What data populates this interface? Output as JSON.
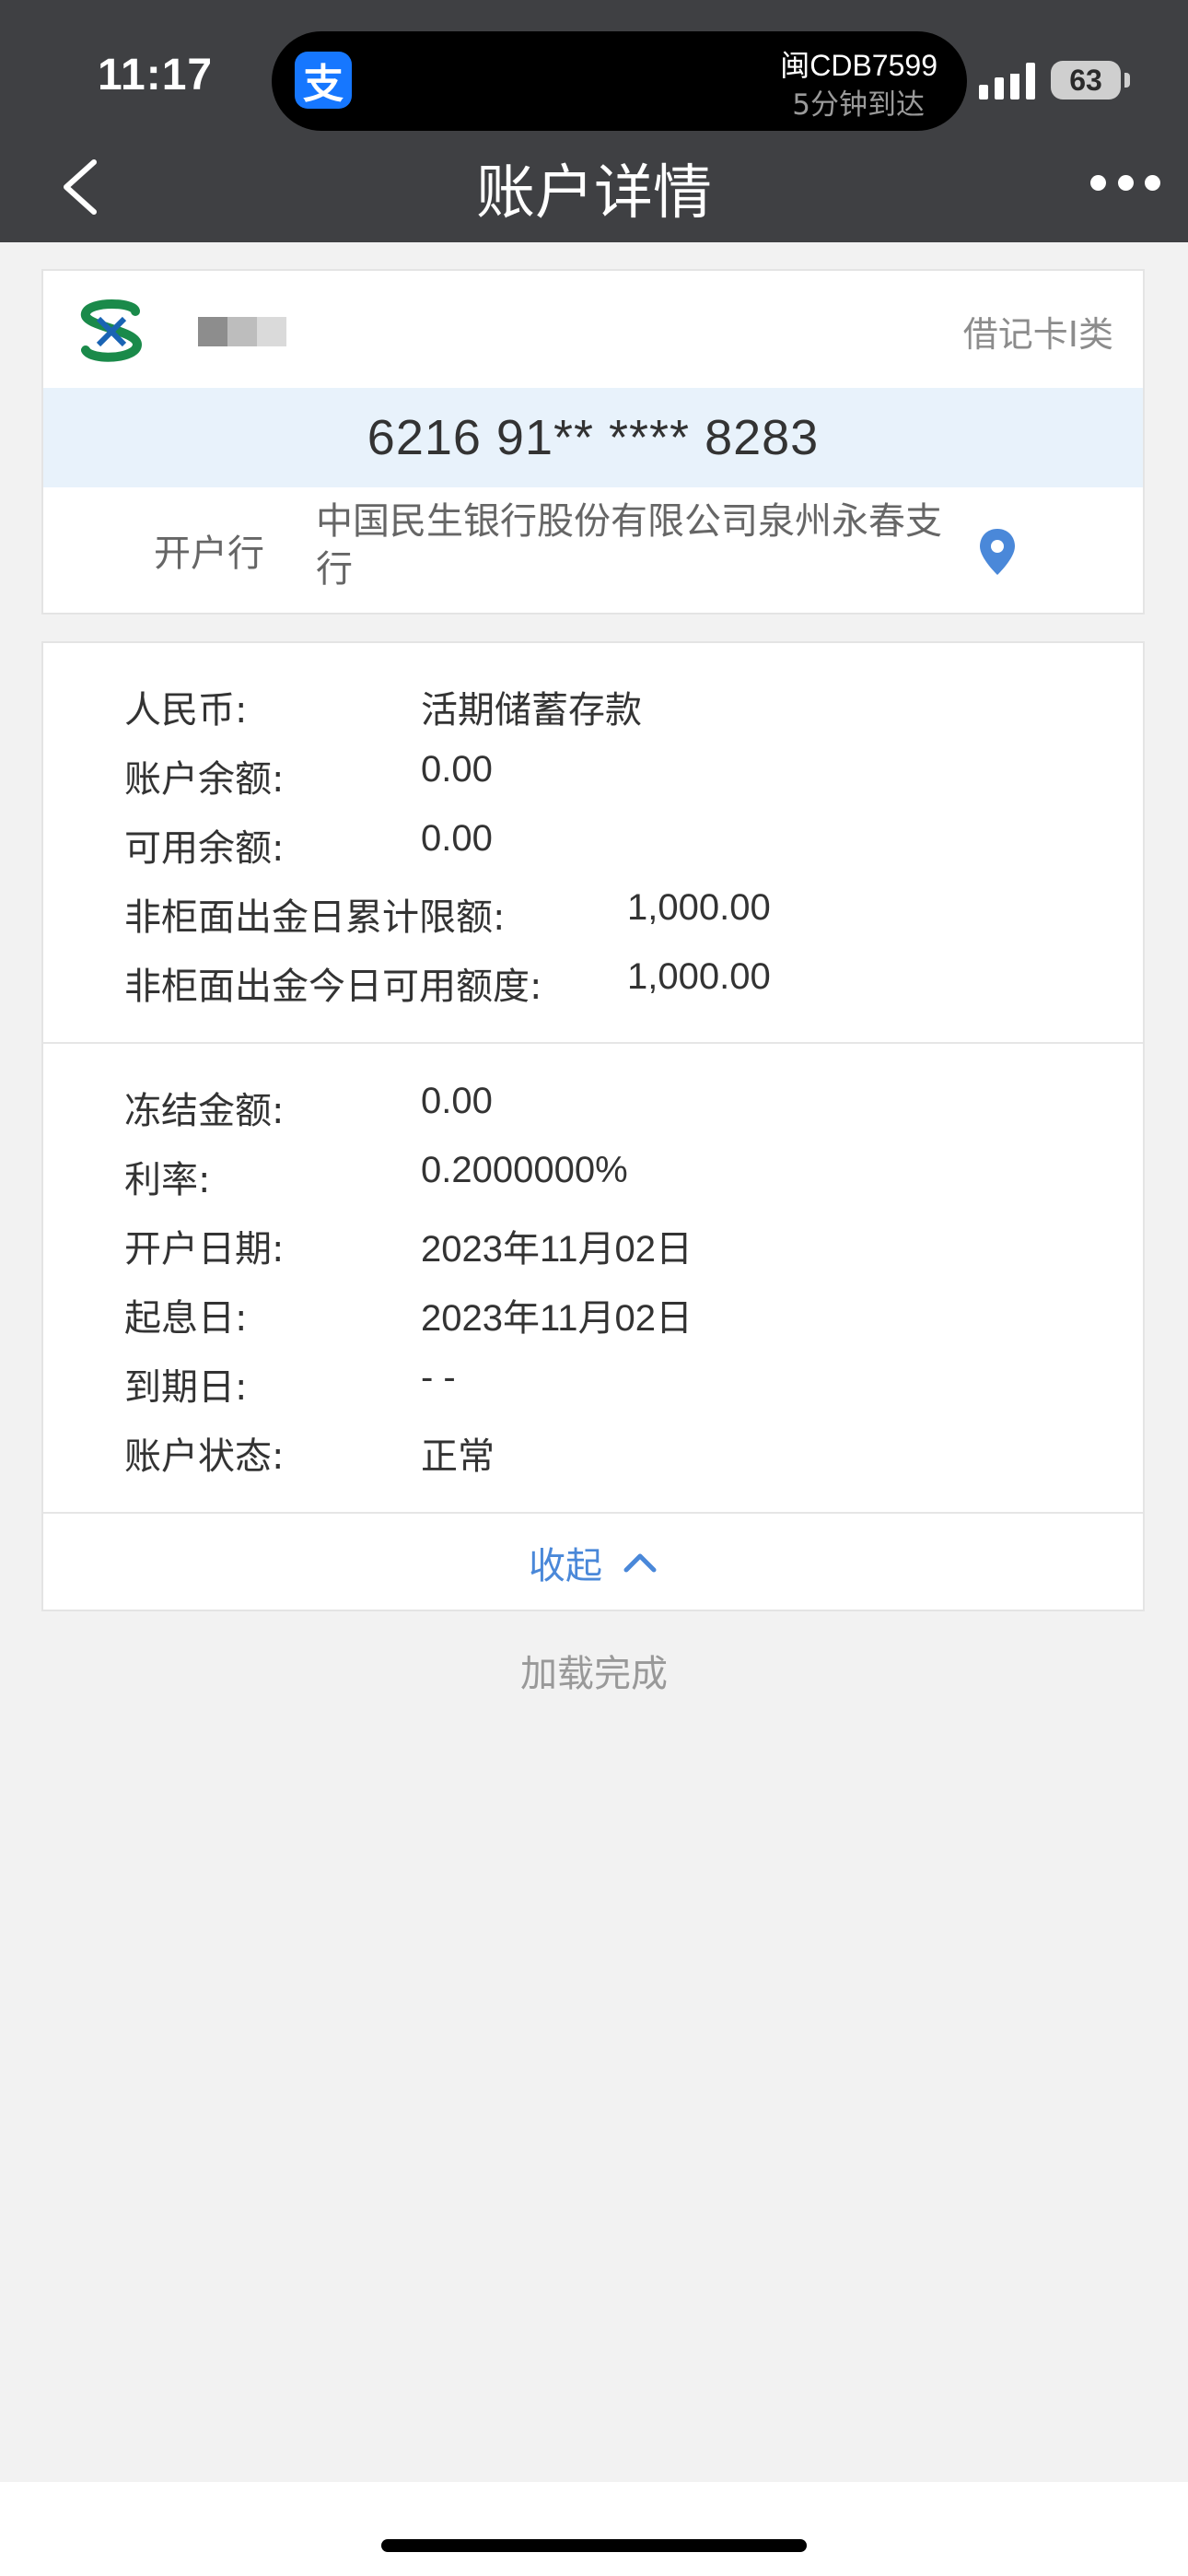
{
  "status_bar": {
    "time": "11:17",
    "island_main": "闽CDB7599",
    "island_sub": "5分钟到达",
    "battery": "63",
    "app_icon": "alipay-icon"
  },
  "nav": {
    "title": "账户详情",
    "back_icon": "chevron-left-icon",
    "more_icon": "more-dots-icon"
  },
  "account": {
    "card_type": "借记卡I类",
    "card_number": "6216 91** **** 8283",
    "bank_label": "开户行",
    "bank_name": "中国民生银行股份有限公司泉州永春支行",
    "location_icon": "location-pin-icon",
    "logo_color": "#1a8a4a",
    "logo_accent": "#1a64b4"
  },
  "details": {
    "section1": [
      {
        "label": "人民币:",
        "value": "活期储蓄存款"
      },
      {
        "label": "账户余额:",
        "value": "0.00"
      },
      {
        "label": "可用余额:",
        "value": "0.00"
      },
      {
        "label": "非柜面出金日累计限额:",
        "value": "1,000.00"
      },
      {
        "label": "非柜面出金今日可用额度:",
        "value": "1,000.00"
      }
    ],
    "section2": [
      {
        "label": "冻结金额:",
        "value": "0.00"
      },
      {
        "label": "利率:",
        "value": "0.2000000%"
      },
      {
        "label": "开户日期:",
        "value": "2023年11月02日"
      },
      {
        "label": "起息日:",
        "value": "2023年11月02日"
      },
      {
        "label": "到期日:",
        "value": "- -"
      },
      {
        "label": "账户状态:",
        "value": "正常"
      }
    ],
    "collapse_label": "收起"
  },
  "footer": {
    "loaded_text": "加载完成"
  },
  "colors": {
    "header_bg": "#3f4043",
    "accent_blue": "#4a88d9",
    "card_number_bg": "#e8f2fb"
  }
}
